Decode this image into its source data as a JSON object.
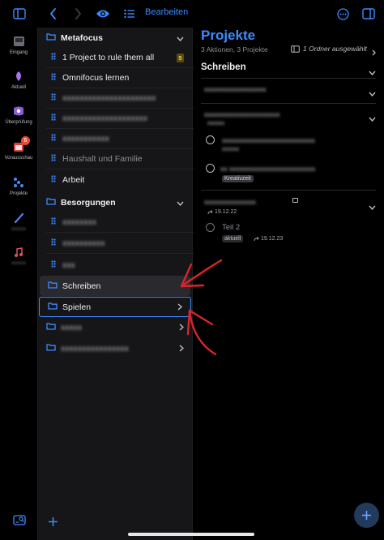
{
  "toolbar": {
    "edit_label": "Bearbeiten",
    "accent": "#3d8bff"
  },
  "rail": {
    "items": [
      {
        "label": "Eingang",
        "icon": "inbox-icon"
      },
      {
        "label": "Aktuell",
        "icon": "flag-icon"
      },
      {
        "label": "Überprüfung",
        "icon": "review-icon"
      },
      {
        "label": "Vorausschau",
        "icon": "calendar-icon",
        "badge": "6"
      },
      {
        "label": "Projekte",
        "icon": "projects-icon"
      }
    ]
  },
  "sidebar": {
    "rows": [
      {
        "label": "Metafocus",
        "type": "group"
      },
      {
        "label": "1 Project to rule them all",
        "type": "project",
        "count": "5"
      },
      {
        "label": "Omnifocus lernen",
        "type": "project"
      },
      {
        "label": "Haushalt und Familie",
        "type": "project",
        "dim": true
      },
      {
        "label": "Arbeit",
        "type": "project"
      },
      {
        "label": "Besorgungen",
        "type": "group"
      },
      {
        "label": "Schreiben",
        "type": "folder",
        "selected": true
      },
      {
        "label": "Spielen",
        "type": "folder",
        "outlined": true
      }
    ]
  },
  "main": {
    "title": "Projekte",
    "subtitle": "3 Aktionen, 3 Projekte",
    "filter": "1 Ordner ausgewählt",
    "section": "Schreiben",
    "tags": {
      "creative": "Kreativzeit",
      "current": "aktuell"
    },
    "dates": {
      "first": "19.12.22",
      "second": "19.12.23"
    },
    "task2": "Teil 2"
  },
  "colors": {
    "background": "#000000",
    "sidebar": "#161618",
    "selected_row": "#2a2a2e",
    "badge_red": "#e84a3c",
    "annotation_red": "#d8252e"
  }
}
